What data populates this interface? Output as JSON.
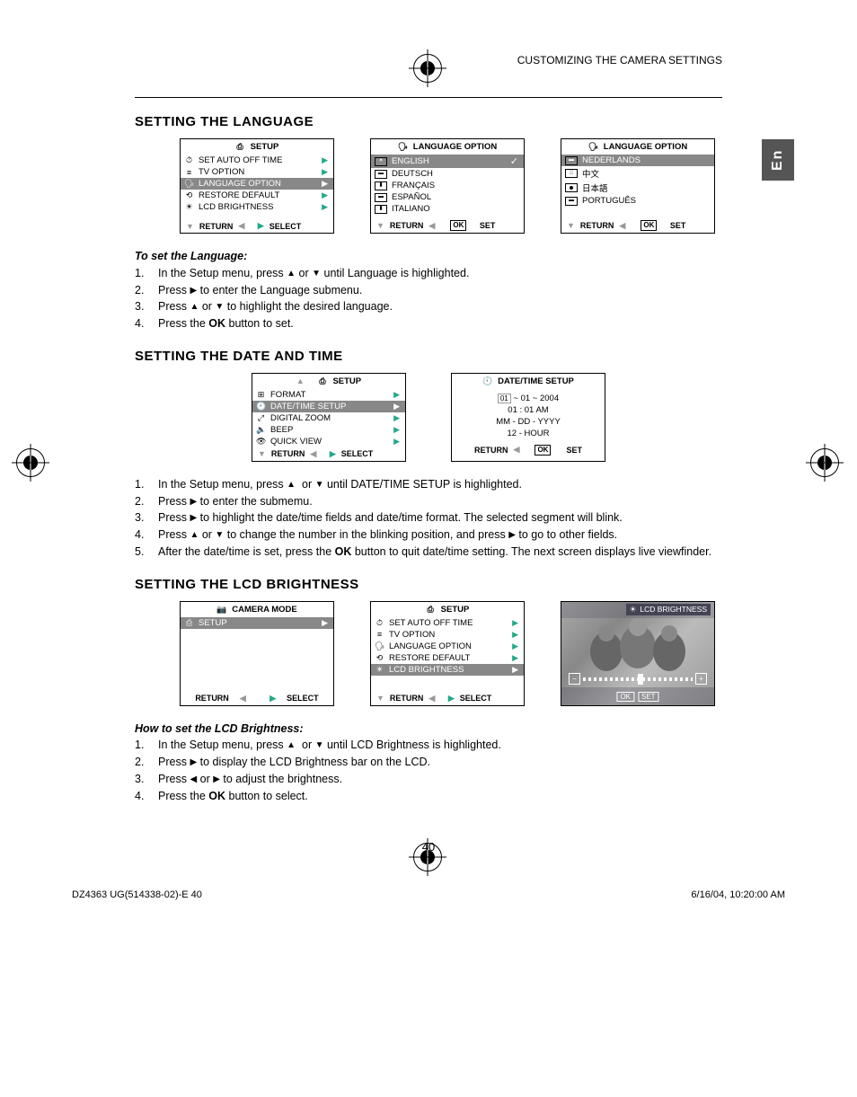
{
  "header": {
    "breadcrumb": "CUSTOMIZING THE CAMERA SETTINGS"
  },
  "side_tab": "En",
  "sections": {
    "language": {
      "heading": "SETTING THE LANGUAGE",
      "setup_screen": {
        "title": "SETUP",
        "items": [
          {
            "icon": "⏱",
            "label": "SET AUTO OFF TIME"
          },
          {
            "icon": "≡",
            "label": "TV OPTION"
          },
          {
            "icon": "🗣",
            "label": "LANGUAGE OPTION",
            "sel": true
          },
          {
            "icon": "⟲",
            "label": "RESTORE DEFAULT"
          },
          {
            "icon": "☀",
            "label": "LCD BRIGHTNESS"
          }
        ],
        "footer_left": "RETURN",
        "footer_right": "SELECT"
      },
      "lang_screen_1": {
        "title": "LANGUAGE  OPTION",
        "items": [
          {
            "label": "ENGLISH",
            "sel": true,
            "check": true
          },
          {
            "label": "DEUTSCH"
          },
          {
            "label": "FRANÇAIS"
          },
          {
            "label": "ESPAÑOL"
          },
          {
            "label": "ITALIANO"
          }
        ],
        "footer_left": "RETURN",
        "footer_right": "SET"
      },
      "lang_screen_2": {
        "title": "LANGUAGE  OPTION",
        "items": [
          {
            "label": "NEDERLANDS",
            "sel": true
          },
          {
            "label": "中文"
          },
          {
            "label": "日本語",
            "flag": "jp"
          },
          {
            "label": "PORTUGUÊS"
          }
        ],
        "footer_left": "RETURN",
        "footer_right": "SET"
      },
      "instructions": {
        "sub": "To set the Language:",
        "steps": [
          "In the Setup menu, press ▲ or ▼ until Language is highlighted.",
          "Press ▶ to enter the Language submenu.",
          "Press ▲ or ▼ to highlight the desired language.",
          "Press the OK button to set."
        ]
      }
    },
    "datetime": {
      "heading": "SETTING THE DATE AND TIME",
      "setup_screen": {
        "title": "SETUP",
        "items": [
          {
            "icon": "⊞",
            "label": "FORMAT"
          },
          {
            "icon": "🕘",
            "label": "DATE/TIME SETUP",
            "sel": true
          },
          {
            "icon": "⤢",
            "label": "DIGITAL ZOOM"
          },
          {
            "icon": "🔈",
            "label": "BEEP"
          },
          {
            "icon": "👁",
            "label": "QUICK VIEW"
          }
        ],
        "footer_left": "RETURN",
        "footer_right": "SELECT"
      },
      "dt_screen": {
        "title": "DATE/TIME SETUP",
        "date": "01 ~ 01 ~ 2004",
        "time": "01 : 01 AM",
        "format": "MM - DD - YYYY",
        "clock": "12 - HOUR",
        "footer_left": "RETURN",
        "footer_right": "SET"
      },
      "instructions": {
        "steps": [
          "In the Setup menu, press ▲  or ▼ until DATE/TIME SETUP is highlighted.",
          "Press ▶ to enter the submemu.",
          "Press ▶ to highlight the date/time fields and date/time format. The selected segment will blink.",
          "Press ▲ or ▼ to change the number in the blinking position, and press ▶ to go to other fields.",
          "After the date/time is set, press the OK button to quit date/time setting. The next screen displays live viewfinder."
        ]
      }
    },
    "brightness": {
      "heading": "SETTING THE LCD BRIGHTNESS",
      "camera_mode_screen": {
        "title": "CAMERA MODE",
        "item": "SETUP",
        "footer_left": "RETURN",
        "footer_right": "SELECT"
      },
      "setup_screen": {
        "title": "SETUP",
        "items": [
          {
            "icon": "⏱",
            "label": "SET AUTO OFF TIME"
          },
          {
            "icon": "≡",
            "label": "TV OPTION"
          },
          {
            "icon": "🗣",
            "label": "LANGUAGE OPTION"
          },
          {
            "icon": "⟲",
            "label": "RESTORE DEFAULT"
          },
          {
            "icon": "☀",
            "label": "LCD BRIGHTNESS",
            "sel": true
          }
        ],
        "footer_left": "RETURN",
        "footer_right": "SELECT"
      },
      "preview_title": "LCD BRIGHTNESS",
      "preview_ok": "OK",
      "preview_set": "SET",
      "instructions": {
        "sub": "How to set the LCD Brightness:",
        "steps": [
          "In the Setup menu, press ▲  or ▼ until LCD Brightness is highlighted.",
          "Press ▶ to display the LCD Brightness bar on the LCD.",
          "Press ◀ or ▶ to adjust the brightness.",
          "Press the OK button to select."
        ]
      }
    }
  },
  "page_number": "40",
  "footer": {
    "left": "DZ4363 UG(514338-02)-E   40",
    "right": "6/16/04, 10:20:00 AM"
  }
}
